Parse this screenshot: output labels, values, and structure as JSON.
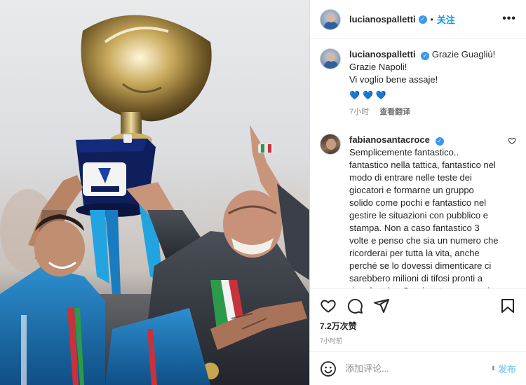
{
  "header": {
    "username": "lucianospalletti",
    "separator": "•",
    "follow_label": "关注",
    "more_icon": "more-horizontal-icon"
  },
  "caption": {
    "username": "lucianospalletti",
    "lines": [
      "Grazie Guagliú!",
      "Grazie Napoli!",
      "Vi voglio bene assaje!"
    ],
    "hearts": "💙💙💙",
    "time": "7小时",
    "translate_label": "查看翻译"
  },
  "comment": {
    "username": "fabianosantacroce",
    "text": "Semplicemente fantastico.. fantastico nella tattica, fantastico nel modo di entrare nelle teste dei giocatori e formarne un gruppo solido come pochi e fantastico nel gestire le situazioni con pubblico e stampa. Non a caso fantastico 3 volte e penso che sia un numero che ricorderai per tutta la vita, anche perché se lo dovessi dimenticare ci sarebbero milioni di tifosi pronti a ricordartelo.. Grazie a te per averci"
  },
  "actions": {
    "likes": "7.2万次赞",
    "time_ago": "7小时前"
  },
  "add_comment": {
    "placeholder": "添加评论...",
    "post_label": "发布"
  },
  "colors": {
    "accent": "#0095f6",
    "verified": "#3897f0",
    "napoli_blue": "#1a8fd6"
  }
}
